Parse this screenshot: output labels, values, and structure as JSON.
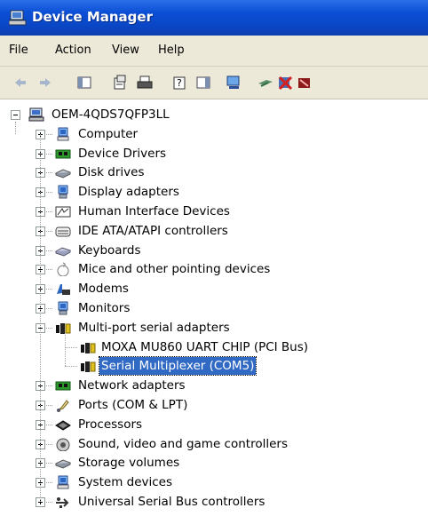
{
  "window": {
    "title": "Device Manager"
  },
  "menu": {
    "file": "File",
    "action": "Action",
    "view": "View",
    "help": "Help"
  },
  "toolbar": {
    "icons": [
      "back-arrow-icon",
      "forward-arrow-icon",
      "console-tree-icon",
      "properties-icon",
      "print-icon",
      "help-icon",
      "action-pane-icon",
      "scan-hardware-icon",
      "update-driver-icon",
      "uninstall-icon",
      "disable-icon"
    ]
  },
  "tree": {
    "root": "OEM-4QDS7QFP3LL",
    "categories": [
      {
        "label": "Computer",
        "icon": "computer-icon"
      },
      {
        "label": "Device Drivers",
        "icon": "chip-card-icon"
      },
      {
        "label": "Disk drives",
        "icon": "disk-drive-icon"
      },
      {
        "label": "Display adapters",
        "icon": "monitor-icon"
      },
      {
        "label": "Human Interface Devices",
        "icon": "hid-icon"
      },
      {
        "label": "IDE ATA/ATAPI controllers",
        "icon": "ide-controller-icon"
      },
      {
        "label": "Keyboards",
        "icon": "keyboard-icon"
      },
      {
        "label": "Mice and other pointing devices",
        "icon": "mouse-icon"
      },
      {
        "label": "Modems",
        "icon": "modem-icon"
      },
      {
        "label": "Monitors",
        "icon": "monitor-icon"
      },
      {
        "label": "Multi-port serial adapters",
        "icon": "serial-port-icon",
        "expanded": true,
        "children": [
          "MOXA MU860 UART CHIP (PCI Bus)",
          "Serial Multiplexer (COM5)"
        ]
      },
      {
        "label": "Network adapters",
        "icon": "network-card-icon"
      },
      {
        "label": "Ports (COM & LPT)",
        "icon": "port-icon"
      },
      {
        "label": "Processors",
        "icon": "processor-icon"
      },
      {
        "label": "Sound, video and game controllers",
        "icon": "speaker-icon"
      },
      {
        "label": "Storage volumes",
        "icon": "storage-volume-icon"
      },
      {
        "label": "System devices",
        "icon": "system-device-icon"
      },
      {
        "label": "Universal Serial Bus controllers",
        "icon": "usb-icon"
      }
    ],
    "selected": "Serial Multiplexer (COM5)"
  }
}
